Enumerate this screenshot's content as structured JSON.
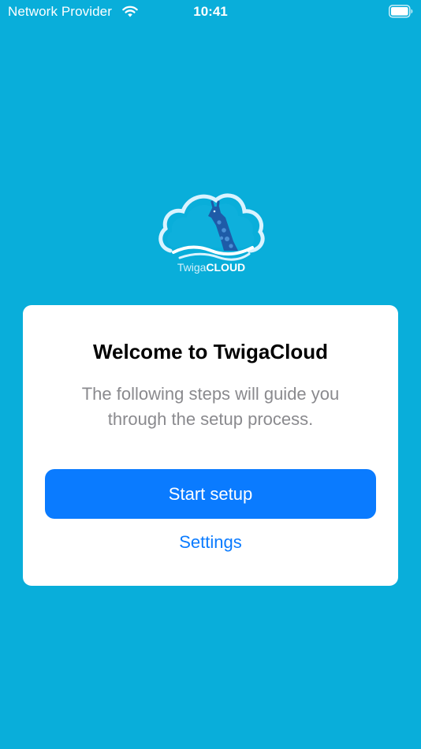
{
  "status_bar": {
    "carrier": "Network Provider",
    "time": "10:41",
    "wifi_icon": "wifi-icon",
    "battery_icon": "battery-icon"
  },
  "logo": {
    "text_part1": "Twiga",
    "text_part2": "CLOUD",
    "icon": "giraffe-cloud-logo-icon"
  },
  "welcome_card": {
    "title": "Welcome to TwigaCloud",
    "description": "The following steps will guide you through the setup process.",
    "start_button_label": "Start setup",
    "settings_link_label": "Settings"
  },
  "colors": {
    "background": "#09AEDA",
    "card": "#FFFFFF",
    "accent": "#0A7BFF",
    "description_text": "#8A8A8E"
  }
}
